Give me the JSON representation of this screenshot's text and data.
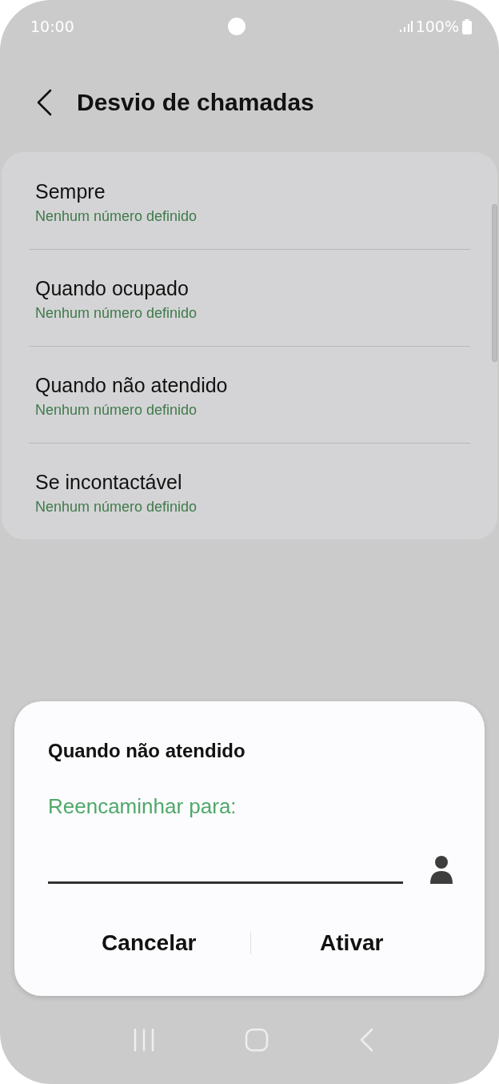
{
  "status_bar": {
    "time": "10:00",
    "battery": "100%"
  },
  "header": {
    "title": "Desvio de chamadas"
  },
  "options": [
    {
      "title": "Sempre",
      "subtitle": "Nenhum número definido"
    },
    {
      "title": "Quando ocupado",
      "subtitle": "Nenhum número definido"
    },
    {
      "title": "Quando não atendido",
      "subtitle": "Nenhum número definido"
    },
    {
      "title": "Se incontactável",
      "subtitle": "Nenhum número definido"
    }
  ],
  "dialog": {
    "title": "Quando não atendido",
    "label": "Reencaminhar para:",
    "buttons": [
      "Cancelar",
      "Ativar"
    ]
  }
}
